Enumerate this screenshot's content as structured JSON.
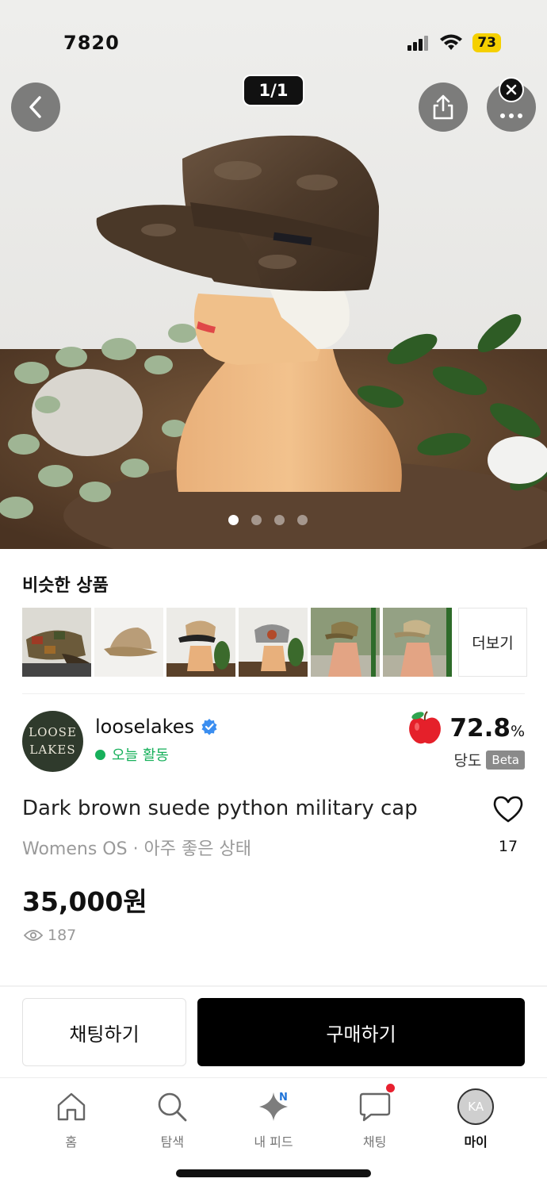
{
  "status_bar": {
    "time": "7820",
    "battery": "73"
  },
  "gallery": {
    "counter": "1/1",
    "page_count": 4,
    "active_page": 1
  },
  "similar": {
    "title": "비슷한 상품",
    "more_label": "더보기",
    "items": [
      "camo-cap",
      "beige-cap",
      "checked-cap",
      "grey-patch-cap",
      "khaki-cap",
      "tan-cap"
    ]
  },
  "seller": {
    "avatar_text_line1": "LOOSE",
    "avatar_text_line2": "LAKES",
    "name": "looselakes",
    "status": "오늘 활동",
    "sweetness_value": "72.8",
    "sweetness_unit": "%",
    "sweetness_label": "당도",
    "beta_label": "Beta"
  },
  "product": {
    "title": "Dark brown suede python military cap",
    "meta": "Womens OS · 아주 좋은 상태",
    "likes": "17",
    "price": "35,000원",
    "views": "187"
  },
  "actions": {
    "chat_label": "채팅하기",
    "buy_label": "구매하기"
  },
  "nav": {
    "items": [
      {
        "label": "홈",
        "icon": "home-icon"
      },
      {
        "label": "탐색",
        "icon": "search-icon"
      },
      {
        "label": "내 피드",
        "icon": "sparkle-icon",
        "badge": "N"
      },
      {
        "label": "채팅",
        "icon": "chat-bubble-icon"
      },
      {
        "label": "마이",
        "icon": "avatar-icon",
        "avatar_text": "KA"
      }
    ]
  },
  "colors": {
    "accent_green": "#17b05b",
    "badge_blue": "#1f73d8",
    "alert_red": "#e8202f",
    "battery_yellow": "#f5d000"
  }
}
